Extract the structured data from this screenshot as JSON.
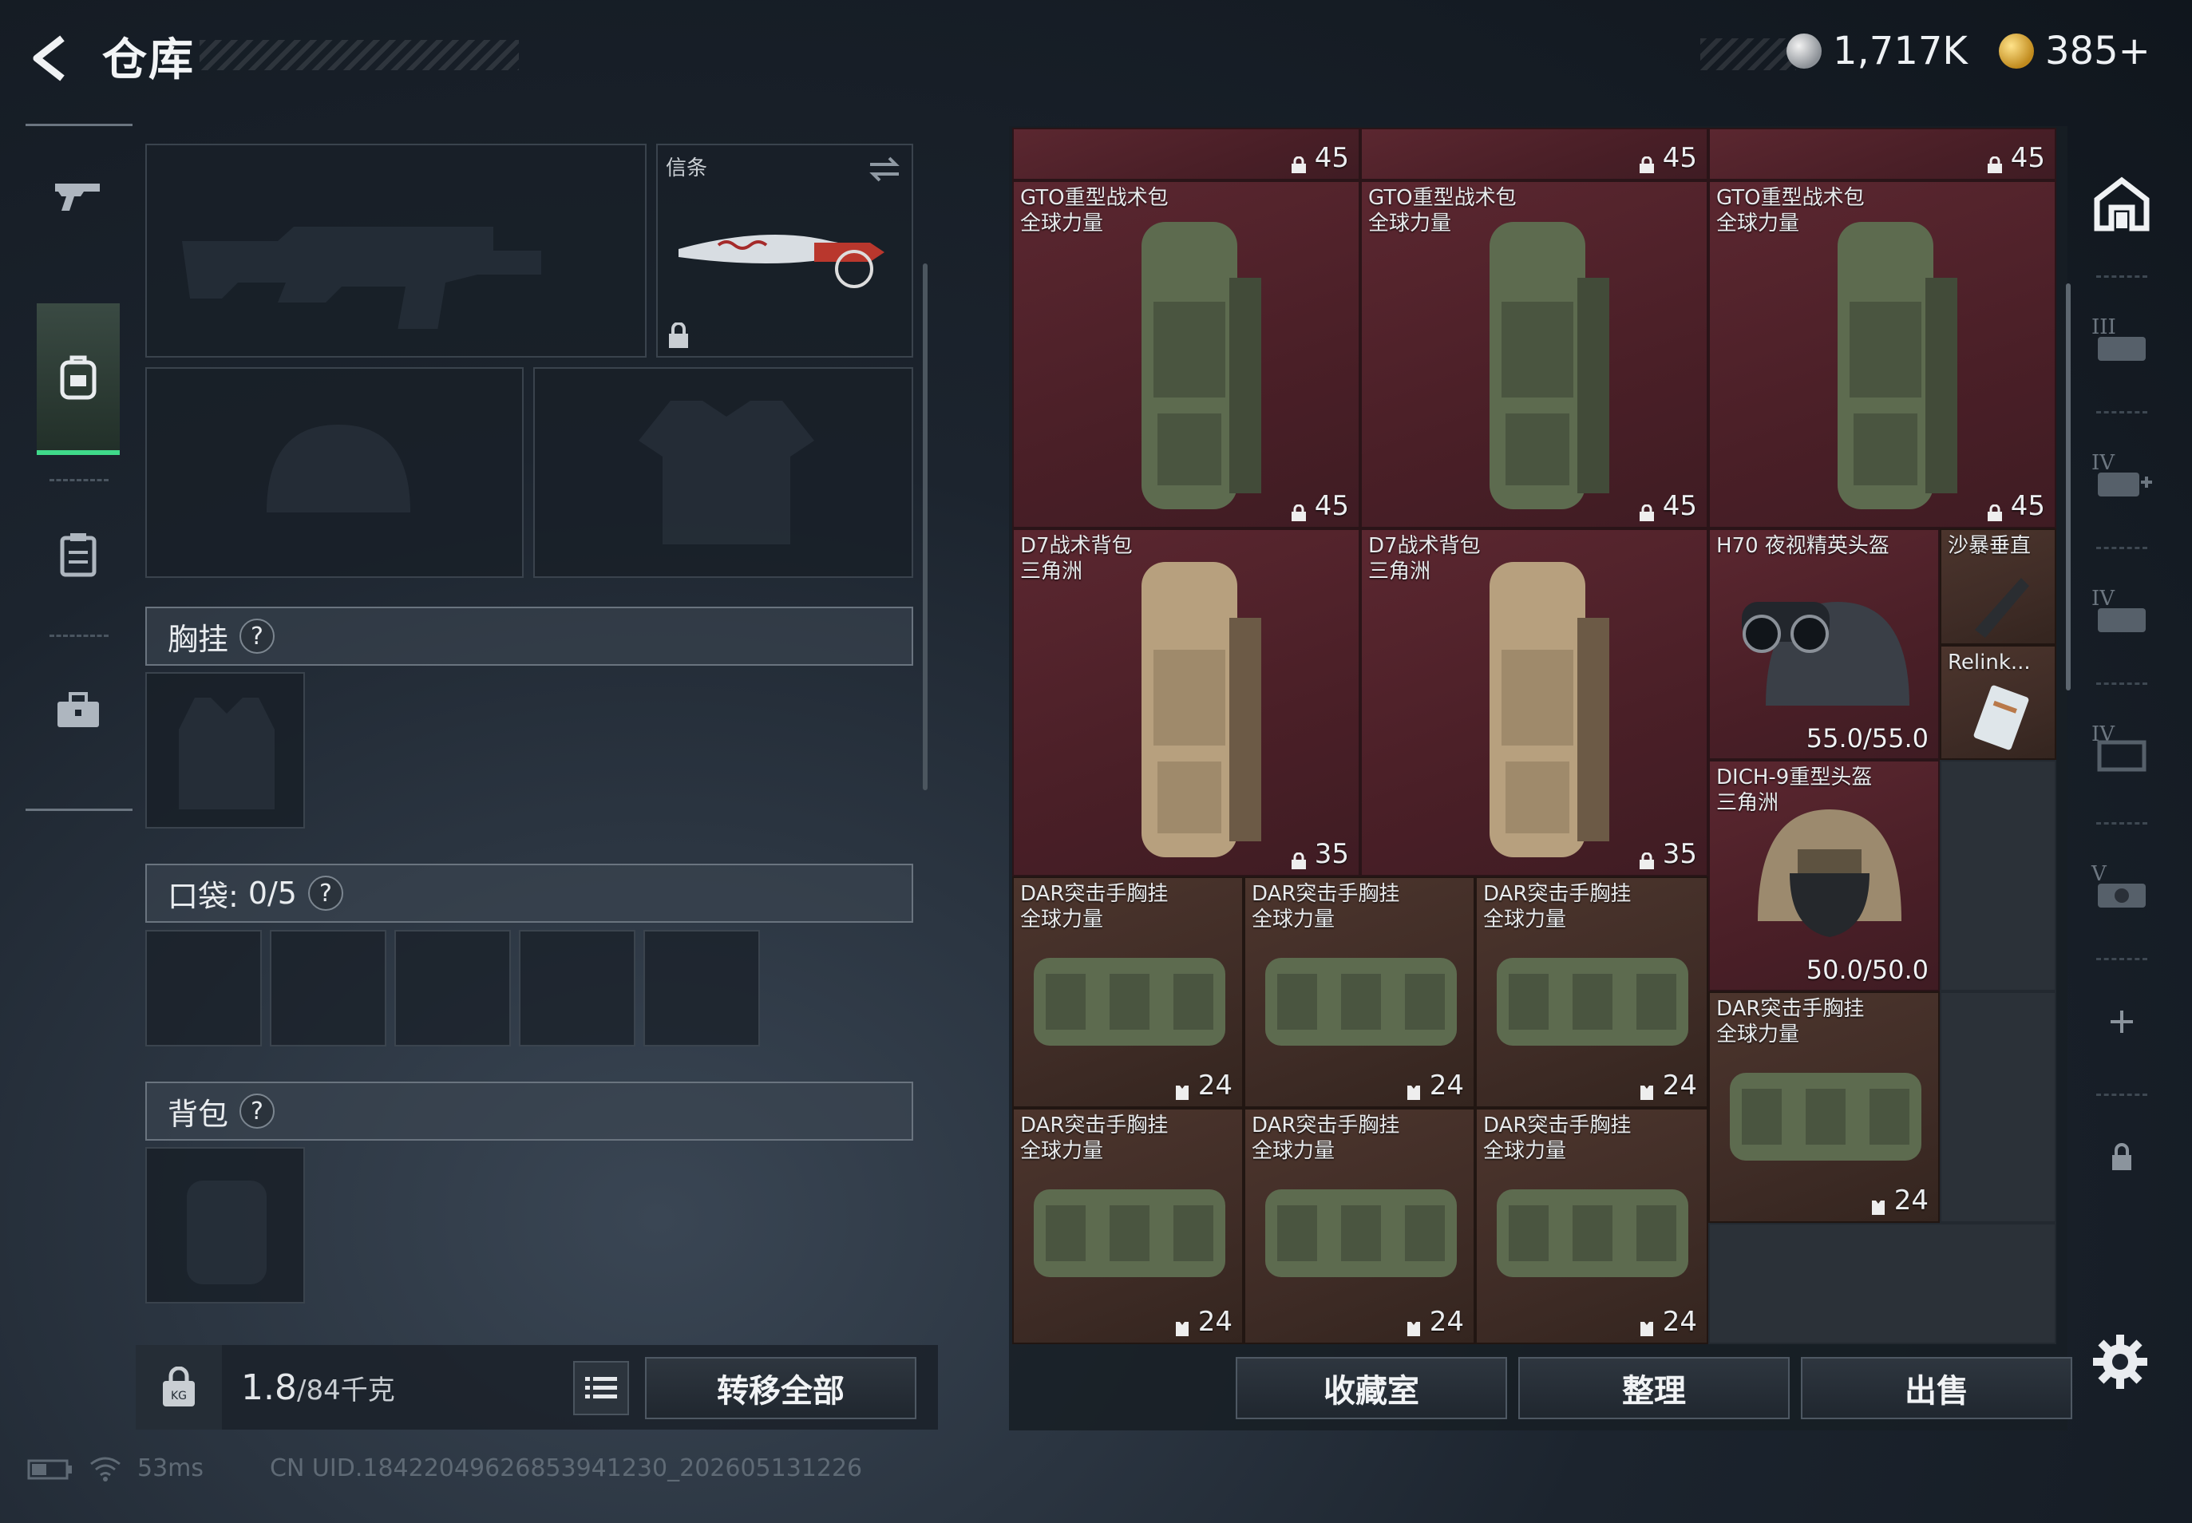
{
  "header": {
    "title": "仓库",
    "currency": [
      {
        "icon": "silver-coin-icon",
        "value": "1,717K"
      },
      {
        "icon": "gold-coin-icon",
        "value": "385+"
      }
    ]
  },
  "left_nav": [
    "gun-icon",
    "backpack-icon",
    "clipboard-icon",
    "briefcase-icon"
  ],
  "loadout": {
    "melee_label": "信条",
    "chest_rig_label": "胸挂",
    "pocket_label": "口袋:",
    "pocket_count": "0/5",
    "backpack_label": "背包",
    "help": "?",
    "weight_current": "1.8",
    "weight_max": "/84千克",
    "transfer_all": "转移全部"
  },
  "grid": {
    "top_caps": [
      "45",
      "45",
      "45"
    ],
    "items": [
      {
        "name": "GTO重型战术包\n全球力量",
        "cap": "45"
      },
      {
        "name": "GTO重型战术包\n全球力量",
        "cap": "45"
      },
      {
        "name": "GTO重型战术包\n全球力量",
        "cap": "45"
      },
      {
        "name": "D7战术背包\n三角洲",
        "cap": "35"
      },
      {
        "name": "D7战术背包\n三角洲",
        "cap": "35"
      },
      {
        "name": "H70 夜视精英头盔",
        "dur": "55.0/55.0"
      },
      {
        "name": "沙暴垂直"
      },
      {
        "name": "Relink..."
      },
      {
        "name": "DICH-9重型头盔\n三角洲",
        "dur": "50.0/50.0"
      },
      {
        "name": "DAR突击手胸挂\n全球力量",
        "cap": "24"
      },
      {
        "name": "DAR突击手胸挂\n全球力量",
        "cap": "24"
      },
      {
        "name": "DAR突击手胸挂\n全球力量",
        "cap": "24"
      },
      {
        "name": "DAR突击手胸挂\n全球力量",
        "cap": "24"
      },
      {
        "name": "DAR突击手胸挂\n全球力量",
        "cap": "24"
      },
      {
        "name": "DAR突击手胸挂\n全球力量",
        "cap": "24"
      },
      {
        "name": "DAR突击手胸挂\n全球力量",
        "cap": "24"
      }
    ]
  },
  "bottom_buttons": {
    "collection": "收藏室",
    "sort": "整理",
    "sell": "出售"
  },
  "right_bar": [
    "storage-home-icon",
    "storage-tier-iii-icon",
    "storage-tier-iv-add-icon",
    "storage-tier-iv-icon",
    "storage-tier-iv-b-icon",
    "storage-tier-v-icon",
    "plus-icon",
    "lock-icon"
  ],
  "status_bar": {
    "ping": "53ms",
    "uid": "CN UID.18422049626853941230_202605131226"
  },
  "colors": {
    "accent_green": "#3fd98a",
    "cell_red": "#4a1f27",
    "cell_brown": "#3f2c26"
  }
}
